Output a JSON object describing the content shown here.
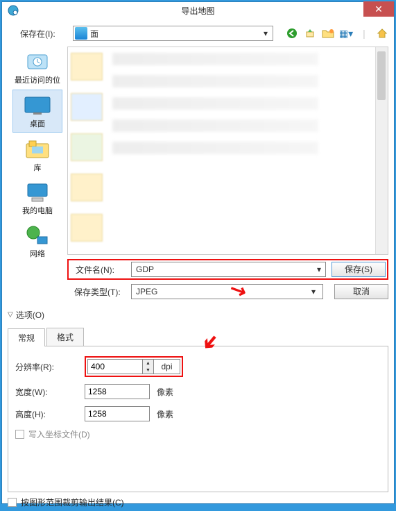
{
  "title": "导出地图",
  "savein": {
    "label": "保存在(I):",
    "value": "面"
  },
  "places": {
    "recent": "最近访问的位",
    "desktop": "桌面",
    "libraries": "库",
    "mycomputer": "我的电脑",
    "network": "网络"
  },
  "filename": {
    "label": "文件名(N):",
    "value": "GDP"
  },
  "filetype": {
    "label": "保存类型(T):",
    "value": "JPEG"
  },
  "buttons": {
    "save": "保存(S)",
    "cancel": "取消"
  },
  "options": {
    "label": "选项(O)"
  },
  "tabs": {
    "general": "常规",
    "format": "格式"
  },
  "form": {
    "resolution_label": "分辨率(R):",
    "resolution_value": "400",
    "resolution_unit": "dpi",
    "width_label": "宽度(W):",
    "width_value": "1258",
    "width_unit": "像素",
    "height_label": "高度(H):",
    "height_value": "1258",
    "height_unit": "像素",
    "writeworld_label": "写入坐标文件(D)"
  },
  "bottom_cb": "按图形范围裁剪输出结果(C)"
}
